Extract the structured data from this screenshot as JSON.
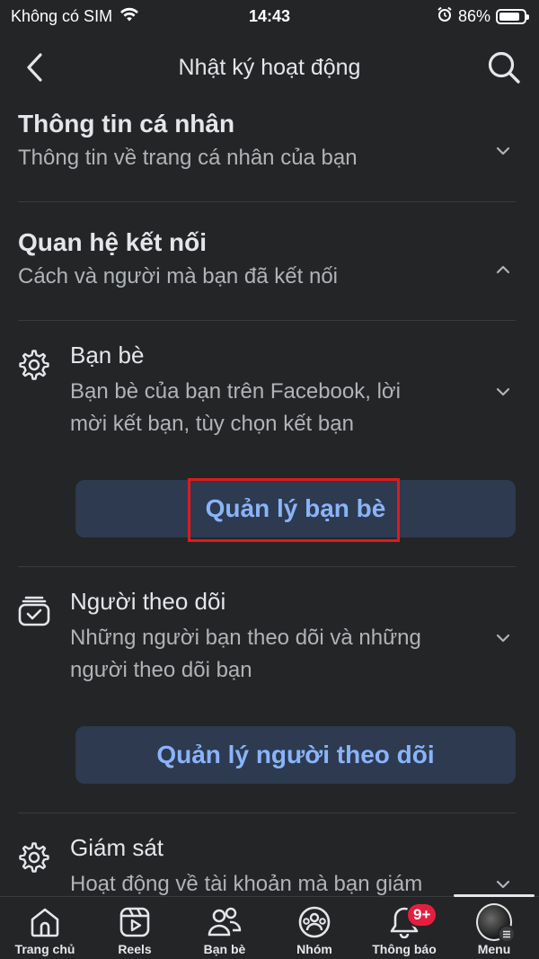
{
  "status": {
    "carrier": "Không có SIM",
    "time": "14:43",
    "battery": "86%",
    "battery_level": 0.86
  },
  "header": {
    "title": "Nhật ký hoạt động"
  },
  "sections": {
    "personal": {
      "title": "Thông tin cá nhân",
      "subtitle": "Thông tin về trang cá nhân của bạn"
    },
    "connections": {
      "title": "Quan hệ kết nối",
      "subtitle": "Cách và người mà bạn đã kết nối"
    }
  },
  "items": {
    "friends": {
      "title": "Bạn bè",
      "desc_line1": "Bạn bè của bạn trên Facebook, lời",
      "desc_line2": "mời kết bạn, tùy chọn kết bạn",
      "button": "Quản lý bạn bè"
    },
    "followers": {
      "title": "Người theo dõi",
      "desc_line1": "Những người bạn theo dõi và những",
      "desc_line2": "người theo dõi bạn",
      "button": "Quản lý người theo dõi"
    },
    "supervision": {
      "title": "Giám sát",
      "desc_line1": "Hoạt động về tài khoản mà bạn giám"
    }
  },
  "tabbar": {
    "home": "Trang chủ",
    "reels": "Reels",
    "friends": "Bạn bè",
    "groups": "Nhóm",
    "notifications": "Thông báo",
    "notifications_badge": "9+",
    "menu": "Menu"
  },
  "colors": {
    "background": "#242526",
    "button_bg": "#2d3a50",
    "button_text": "#8ab4f8",
    "highlight": "#e0191e",
    "badge": "#e41e3f"
  }
}
